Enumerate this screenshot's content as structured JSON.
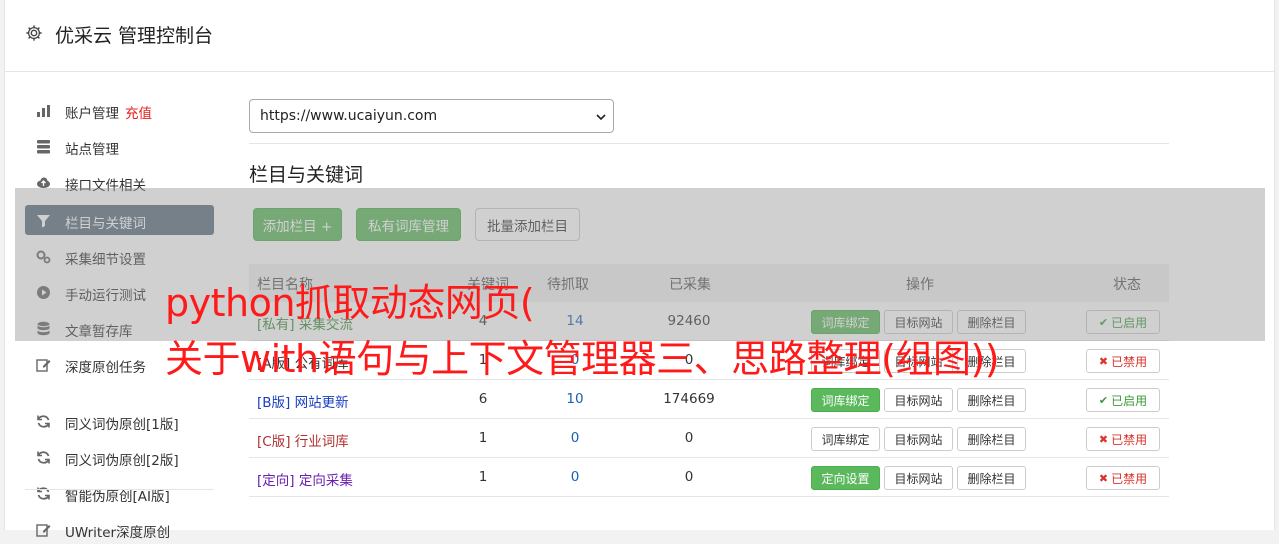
{
  "app": {
    "title": "优采云 管理控制台"
  },
  "sidebar": {
    "items": [
      {
        "label": "账户管理",
        "badge": "充值",
        "icon": "bar-chart-icon"
      },
      {
        "label": "站点管理",
        "icon": "server-icon"
      },
      {
        "label": "接口文件相关",
        "icon": "cloud-upload-icon"
      },
      {
        "label": "栏目与关键词",
        "icon": "filter-icon",
        "active": true
      },
      {
        "label": "采集细节设置",
        "icon": "gears-icon"
      },
      {
        "label": "手动运行测试",
        "icon": "play-circle-icon"
      },
      {
        "label": "文章暂存库",
        "icon": "database-icon"
      },
      {
        "label": "深度原创任务",
        "icon": "edit-icon"
      },
      {
        "label": "同义词伪原创[1版]",
        "icon": "refresh-icon"
      },
      {
        "label": "同义词伪原创[2版]",
        "icon": "refresh-icon"
      },
      {
        "label": "智能伪原创[AI版]",
        "icon": "refresh-icon"
      },
      {
        "label": "UWriter深度原创",
        "icon": "edit-icon"
      }
    ]
  },
  "site_select": {
    "value": "https://www.ucaiyun.com"
  },
  "section": {
    "title": "栏目与关键词"
  },
  "toolbar": {
    "add_column": "添加栏目 +",
    "private_lib": "私有词库管理",
    "batch_add": "批量添加栏目"
  },
  "table": {
    "headers": [
      "栏目名称",
      "关键词",
      "待抓取",
      "已采集",
      "操作",
      "状态"
    ],
    "rows": [
      {
        "tag": "[私有]",
        "name": "采集交流",
        "keywords": "4",
        "pending": "14",
        "collected": "92460",
        "op1": "词库绑定",
        "op1_green": true,
        "op2": "目标网站",
        "op3": "删除栏目",
        "status": "已启用",
        "status_on": true,
        "color": "#3c8a3c"
      },
      {
        "tag": "[A版]",
        "name": "公有词库",
        "keywords": "1",
        "pending": "0",
        "collected": "0",
        "op1": "词库绑定",
        "op1_green": false,
        "op2": "目标网站",
        "op3": "删除栏目",
        "status": "已禁用",
        "status_on": false,
        "color": "#333333"
      },
      {
        "tag": "[B版]",
        "name": "网站更新",
        "keywords": "6",
        "pending": "10",
        "collected": "174669",
        "op1": "词库绑定",
        "op1_green": true,
        "op2": "目标网站",
        "op3": "删除栏目",
        "status": "已启用",
        "status_on": true,
        "color": "#1a3fbf"
      },
      {
        "tag": "[C版]",
        "name": "行业词库",
        "keywords": "1",
        "pending": "0",
        "collected": "0",
        "op1": "词库绑定",
        "op1_green": false,
        "op2": "目标网站",
        "op3": "删除栏目",
        "status": "已禁用",
        "status_on": false,
        "color": "#b03030"
      },
      {
        "tag": "[定向]",
        "name": "定向采集",
        "keywords": "1",
        "pending": "0",
        "collected": "0",
        "op1": "定向设置",
        "op1_green": true,
        "op2": "目标网站",
        "op3": "删除栏目",
        "status": "已禁用",
        "status_on": false,
        "color": "#6a1fb0"
      }
    ]
  },
  "watermark": {
    "line1": "python抓取动态网页(",
    "line2": "关于with语句与上下文管理器三、思路整理(组图))"
  }
}
